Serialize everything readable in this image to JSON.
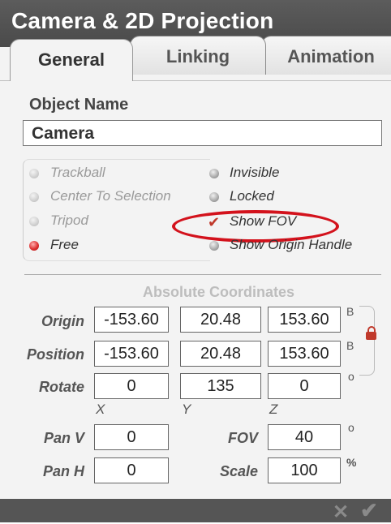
{
  "window": {
    "title": "Camera & 2D Projection"
  },
  "tabs": [
    {
      "label": "General",
      "active": true
    },
    {
      "label": "Linking",
      "active": false
    },
    {
      "label": "Animation",
      "active": false
    }
  ],
  "object_name": {
    "label": "Object Name",
    "value": "Camera"
  },
  "camera_modes": [
    {
      "label": "Trackball",
      "selected": false,
      "enabled": false
    },
    {
      "label": "Center To Selection",
      "selected": false,
      "enabled": false
    },
    {
      "label": "Tripod",
      "selected": false,
      "enabled": false
    },
    {
      "label": "Free",
      "selected": true,
      "enabled": true
    }
  ],
  "toggles": [
    {
      "label": "Invisible",
      "checked": false
    },
    {
      "label": "Locked",
      "checked": false
    },
    {
      "label": "Show FOV",
      "checked": true,
      "highlighted": true
    },
    {
      "label": "Show Origin Handle",
      "checked": false
    }
  ],
  "coords": {
    "title": "Absolute Coordinates",
    "rows": [
      {
        "label": "Origin",
        "x": "-153.60",
        "y": "20.48",
        "z": "153.60",
        "unit": "B"
      },
      {
        "label": "Position",
        "x": "-153.60",
        "y": "20.48",
        "z": "153.60",
        "unit": "B"
      },
      {
        "label": "Rotate",
        "x": "0",
        "y": "135",
        "z": "0",
        "unit": "o"
      }
    ],
    "axes": [
      "X",
      "Y",
      "Z"
    ],
    "lock_icon": "lock-icon"
  },
  "view": {
    "pan_v": {
      "label": "Pan V",
      "value": "0"
    },
    "pan_h": {
      "label": "Pan H",
      "value": "0"
    },
    "fov": {
      "label": "FOV",
      "value": "40",
      "unit": "o"
    },
    "scale": {
      "label": "Scale",
      "value": "100",
      "unit": "%"
    }
  },
  "footer": {
    "cancel_icon": "x-icon",
    "ok_icon": "checkmark-icon",
    "cancel_glyph": "✕",
    "ok_glyph": "✔"
  },
  "colors": {
    "title_bar": "#4f4f4f",
    "highlight_ellipse": "#d3121c",
    "selected_radio": "#d33333",
    "lock": "#c0392b"
  }
}
